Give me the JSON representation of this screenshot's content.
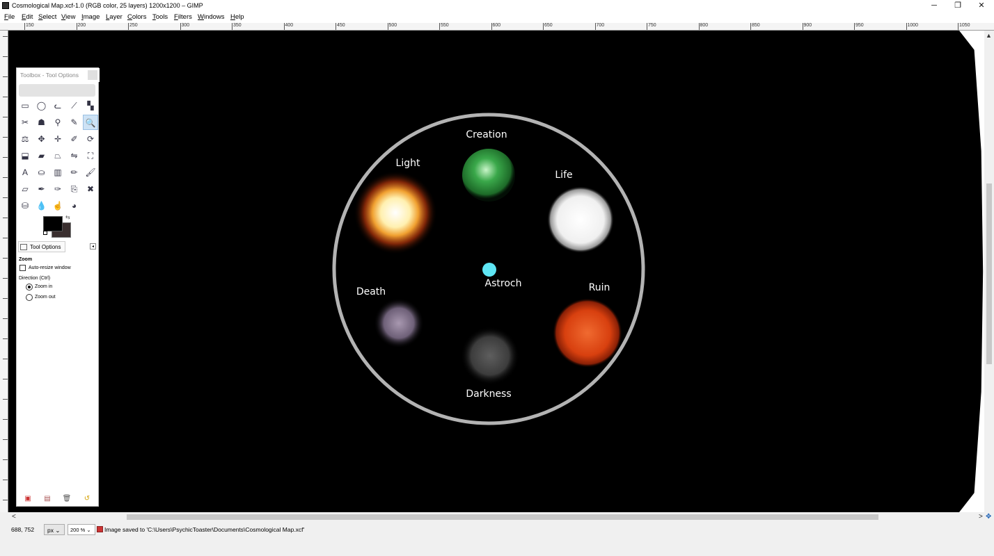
{
  "window": {
    "title": "Cosmological Map.xcf-1.0 (RGB color, 25 layers) 1200x1200 – GIMP",
    "minimize_glyph": "─",
    "restore_glyph": "❐",
    "close_glyph": "✕"
  },
  "menubar": [
    "File",
    "Edit",
    "Select",
    "View",
    "Image",
    "Layer",
    "Colors",
    "Tools",
    "Filters",
    "Windows",
    "Help"
  ],
  "ruler": {
    "labels": [
      "150",
      "200",
      "250",
      "300",
      "350",
      "400",
      "450",
      "500",
      "550",
      "600",
      "650",
      "700",
      "750",
      "800",
      "850",
      "900",
      "950",
      "1000",
      "1050"
    ]
  },
  "toolbox": {
    "title": "Toolbox - Tool Options",
    "tools": [
      {
        "icon": "rect-select-icon",
        "glyph": "▭"
      },
      {
        "icon": "ellipse-select-icon",
        "glyph": "◯"
      },
      {
        "icon": "free-select-icon",
        "glyph": "ᓚ"
      },
      {
        "icon": "fuzzy-select-icon",
        "glyph": "⟋"
      },
      {
        "icon": "select-by-color-icon",
        "glyph": "▚"
      },
      {
        "icon": "scissors-icon",
        "glyph": "✂"
      },
      {
        "icon": "foreground-select-icon",
        "glyph": "☗"
      },
      {
        "icon": "paths-icon",
        "glyph": "⚲"
      },
      {
        "icon": "color-picker-icon",
        "glyph": "✎"
      },
      {
        "icon": "zoom-icon",
        "glyph": "🔍",
        "active": true
      },
      {
        "icon": "measure-icon",
        "glyph": "⚖"
      },
      {
        "icon": "move-icon",
        "glyph": "✥"
      },
      {
        "icon": "align-icon",
        "glyph": "✛"
      },
      {
        "icon": "crop-icon",
        "glyph": "✐"
      },
      {
        "icon": "rotate-icon",
        "glyph": "⟳"
      },
      {
        "icon": "scale-icon",
        "glyph": "⬓"
      },
      {
        "icon": "shear-icon",
        "glyph": "▰"
      },
      {
        "icon": "perspective-icon",
        "glyph": "⏢"
      },
      {
        "icon": "flip-icon",
        "glyph": "⇋"
      },
      {
        "icon": "cage-icon",
        "glyph": "⛶"
      },
      {
        "icon": "text-icon",
        "glyph": "A"
      },
      {
        "icon": "bucket-fill-icon",
        "glyph": "⛀"
      },
      {
        "icon": "blend-icon",
        "glyph": "▥"
      },
      {
        "icon": "pencil-icon",
        "glyph": "✏"
      },
      {
        "icon": "paintbrush-icon",
        "glyph": "🖌"
      },
      {
        "icon": "eraser-icon",
        "glyph": "▱"
      },
      {
        "icon": "airbrush-icon",
        "glyph": "✒"
      },
      {
        "icon": "ink-icon",
        "glyph": "✑"
      },
      {
        "icon": "clone-icon",
        "glyph": "⎘"
      },
      {
        "icon": "heal-icon",
        "glyph": "✖"
      },
      {
        "icon": "perspective-clone-icon",
        "glyph": "⛁"
      },
      {
        "icon": "blur-icon",
        "glyph": "💧"
      },
      {
        "icon": "smudge-icon",
        "glyph": "☝"
      },
      {
        "icon": "dodge-burn-icon",
        "glyph": "◕"
      }
    ],
    "tool_options_tab": "Tool Options",
    "options_heading": "Zoom",
    "auto_resize_label": "Auto-resize window",
    "direction_label": "Direction  (Ctrl)",
    "zoom_in_label": "Zoom in",
    "zoom_out_label": "Zoom out",
    "direction_selected": "Zoom in",
    "auto_resize_checked": false
  },
  "map": {
    "labels": {
      "creation": "Creation",
      "light": "Light",
      "life": "Life",
      "death": "Death",
      "astroch": "Astroch",
      "ruin": "Ruin",
      "darkness": "Darkness"
    },
    "colors": {
      "ring": "#b3b3b3",
      "creation": "#3aa84a",
      "light": "#fff4c8",
      "light_glow": "#d4500a",
      "life": "#ffffff",
      "death": "#8a7a90",
      "astroch": "#5ee6f5",
      "ruin": "#e0451a",
      "darkness": "#555555"
    }
  },
  "statusbar": {
    "coords": "688, 752",
    "unit": "px",
    "zoom": "200 %",
    "message": "Image saved to 'C:\\Users\\PsychicToaster\\Documents\\Cosmological Map.xcf'"
  }
}
